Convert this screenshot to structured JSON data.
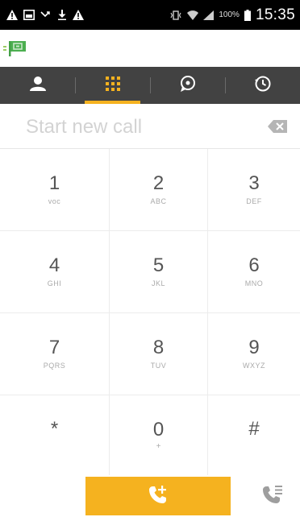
{
  "status_bar": {
    "battery_pct": "100%",
    "time": "15:35",
    "left_icons": [
      "warning-icon",
      "screenshot-icon",
      "missed-call-icon",
      "download-icon",
      "warning-icon"
    ],
    "right_icons": [
      "vibrate-icon",
      "wifi-icon",
      "signal-icon",
      "battery-icon"
    ]
  },
  "app_bar": {
    "logo_icon": "app-logo-icon"
  },
  "tabs": [
    {
      "icon": "contacts-icon",
      "active": false
    },
    {
      "icon": "dialpad-icon",
      "active": true
    },
    {
      "icon": "chat-icon",
      "active": false
    },
    {
      "icon": "history-icon",
      "active": false
    }
  ],
  "dialer": {
    "placeholder": "Start new call",
    "value": "",
    "backspace_icon": "backspace-icon"
  },
  "keypad": {
    "keys": [
      {
        "digit": "1",
        "letters": "voc"
      },
      {
        "digit": "2",
        "letters": "ABC"
      },
      {
        "digit": "3",
        "letters": "DEF"
      },
      {
        "digit": "4",
        "letters": "GHI"
      },
      {
        "digit": "5",
        "letters": "JKL"
      },
      {
        "digit": "6",
        "letters": "MNO"
      },
      {
        "digit": "7",
        "letters": "PQRS"
      },
      {
        "digit": "8",
        "letters": "TUV"
      },
      {
        "digit": "9",
        "letters": "WXYZ"
      },
      {
        "digit": "*",
        "letters": ""
      },
      {
        "digit": "0",
        "letters": "+"
      },
      {
        "digit": "#",
        "letters": ""
      }
    ]
  },
  "bottom_bar": {
    "call_icon": "add-call-icon",
    "call_log_icon": "call-log-icon"
  },
  "colors": {
    "accent": "#f5b21f",
    "tab_bar": "#424242",
    "status_bar": "#000000",
    "logo_green": "#4caf50"
  }
}
